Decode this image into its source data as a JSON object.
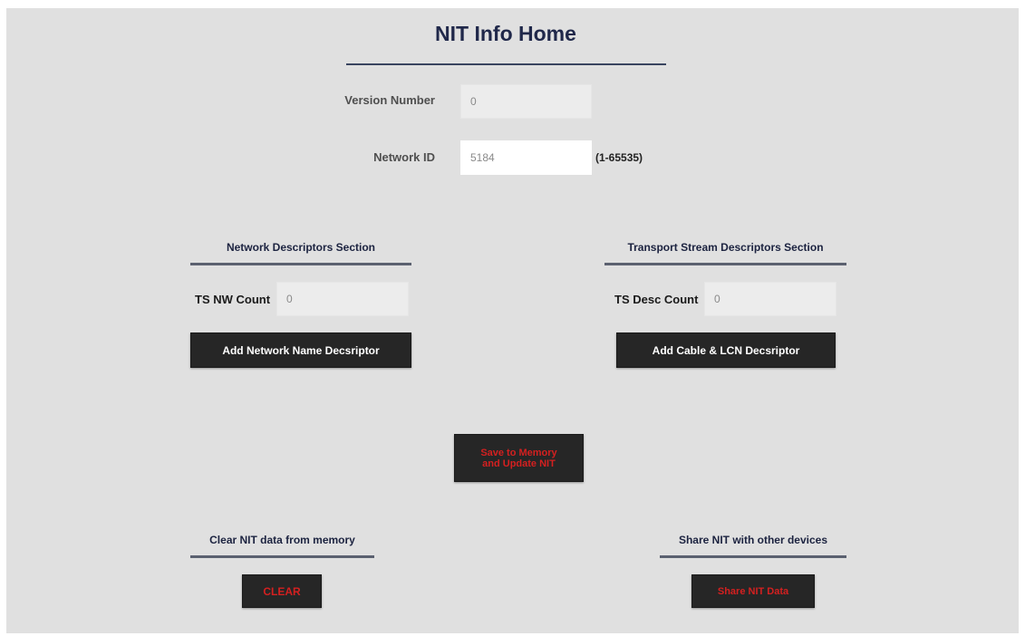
{
  "page": {
    "title": "NIT Info Home"
  },
  "fields": {
    "version_label": "Version Number",
    "version_value": "0",
    "network_id_label": "Network ID",
    "network_id_value": "5184",
    "network_id_hint": "(1-65535)"
  },
  "network_section": {
    "heading": "Network Descriptors Section",
    "count_label": "TS NW Count",
    "count_value": "0",
    "add_button": "Add Network Name Decsriptor"
  },
  "transport_section": {
    "heading": "Transport Stream Descriptors Section",
    "count_label": "TS Desc Count",
    "count_value": "0",
    "add_button": "Add Cable & LCN Decsriptor"
  },
  "save": {
    "line1": "Save to Memory",
    "line2": "and Update NIT"
  },
  "clear_section": {
    "heading": "Clear NIT data from memory",
    "button": "CLEAR"
  },
  "share_section": {
    "heading": "Share NIT with other devices",
    "button": "Share NIT Data"
  },
  "colors": {
    "panel_background": "#e0e0e0",
    "title_color": "#20284a",
    "button_background": "#262626",
    "danger_text": "#d42020"
  }
}
